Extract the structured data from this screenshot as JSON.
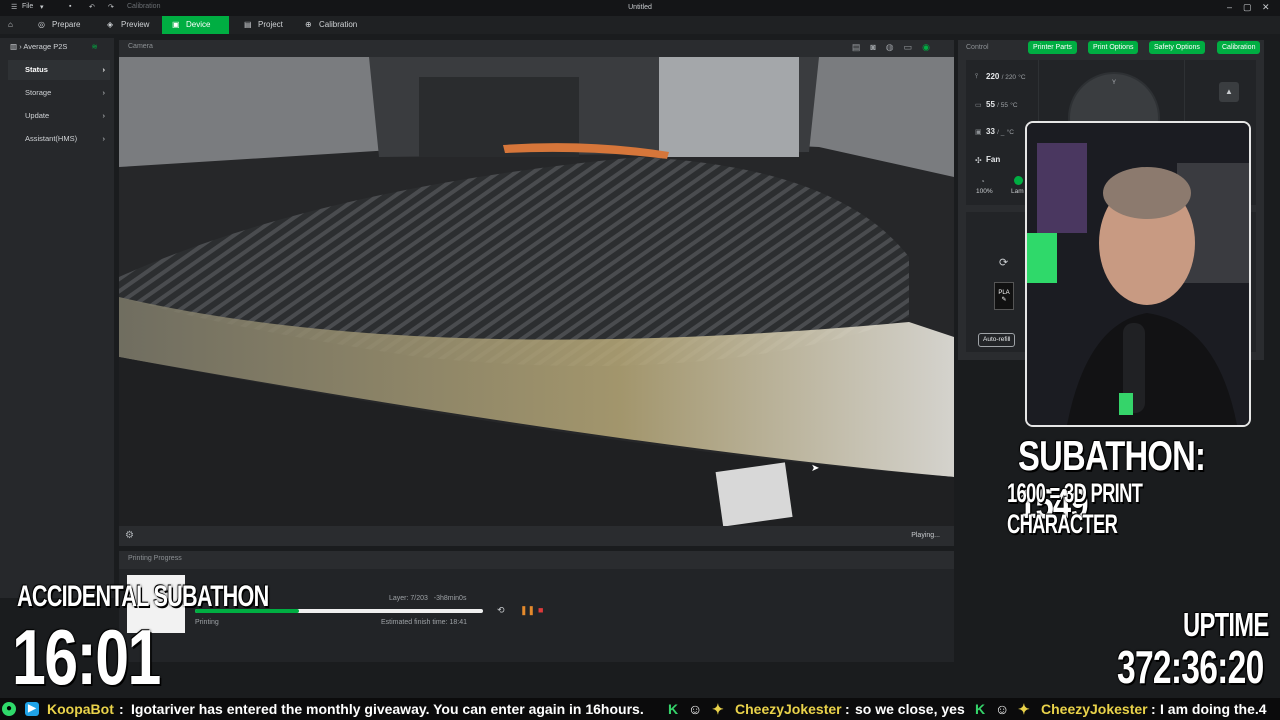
{
  "titlebar": {
    "file_menu": "File",
    "calibration": "Calibration",
    "title": "Untitled"
  },
  "nav": {
    "tabs": [
      {
        "label": "Prepare",
        "active": false
      },
      {
        "label": "Preview",
        "active": false
      },
      {
        "label": "Device",
        "active": true
      },
      {
        "label": "Project",
        "active": false
      },
      {
        "label": "Calibration",
        "active": false
      }
    ]
  },
  "sidebar": {
    "printer_name": "Average P2S",
    "items": [
      {
        "label": "Status",
        "active": true
      },
      {
        "label": "Storage",
        "active": false
      },
      {
        "label": "Update",
        "active": false
      },
      {
        "label": "Assistant(HMS)",
        "active": false
      }
    ]
  },
  "camera": {
    "label": "Camera",
    "status": "Playing..."
  },
  "progress": {
    "label": "Printing Progress",
    "layer": "Layer: 7/203",
    "remaining": "-3h8min0s",
    "status": "Printing",
    "finish_time": "Estimated finish time: 18:41",
    "percent": 36
  },
  "control": {
    "label": "Control",
    "buttons": [
      "Printer Parts",
      "Print Options",
      "Safety Options",
      "Calibration"
    ],
    "nozzle_temp": "220",
    "nozzle_target": "/ 220",
    "bed_temp": "55",
    "bed_target": "/ 55",
    "chamber_temp": "33",
    "chamber_target": "/ _",
    "unit": "°C",
    "fan_label": "Fan",
    "fan_pct": "100%",
    "lamp_label": "Lam",
    "dial_axis": "Y",
    "filament": "PLA",
    "auto_refill": "Auto-refill"
  },
  "overlays": {
    "subathon_count": "SUBATHON: 1549",
    "subathon_goal": "1600 = 3D PRINT CHARACTER",
    "accidental_title": "ACCIDENTAL SUBATHON",
    "accidental_time": "16:01",
    "uptime_label": "UPTIME",
    "uptime_value": "372:36:20"
  },
  "chat": {
    "messages": [
      {
        "user": "KoopaBot",
        "text": "Igotariver has entered the monthly giveaway. You can enter again in 16hours."
      },
      {
        "user": "CheezyJokester",
        "text": "so we close, yes"
      },
      {
        "user": "CheezyJokester",
        "text": "I am doing the.4"
      }
    ]
  },
  "colors": {
    "accent": "#00ae42",
    "name_color": "#e9d24a"
  }
}
